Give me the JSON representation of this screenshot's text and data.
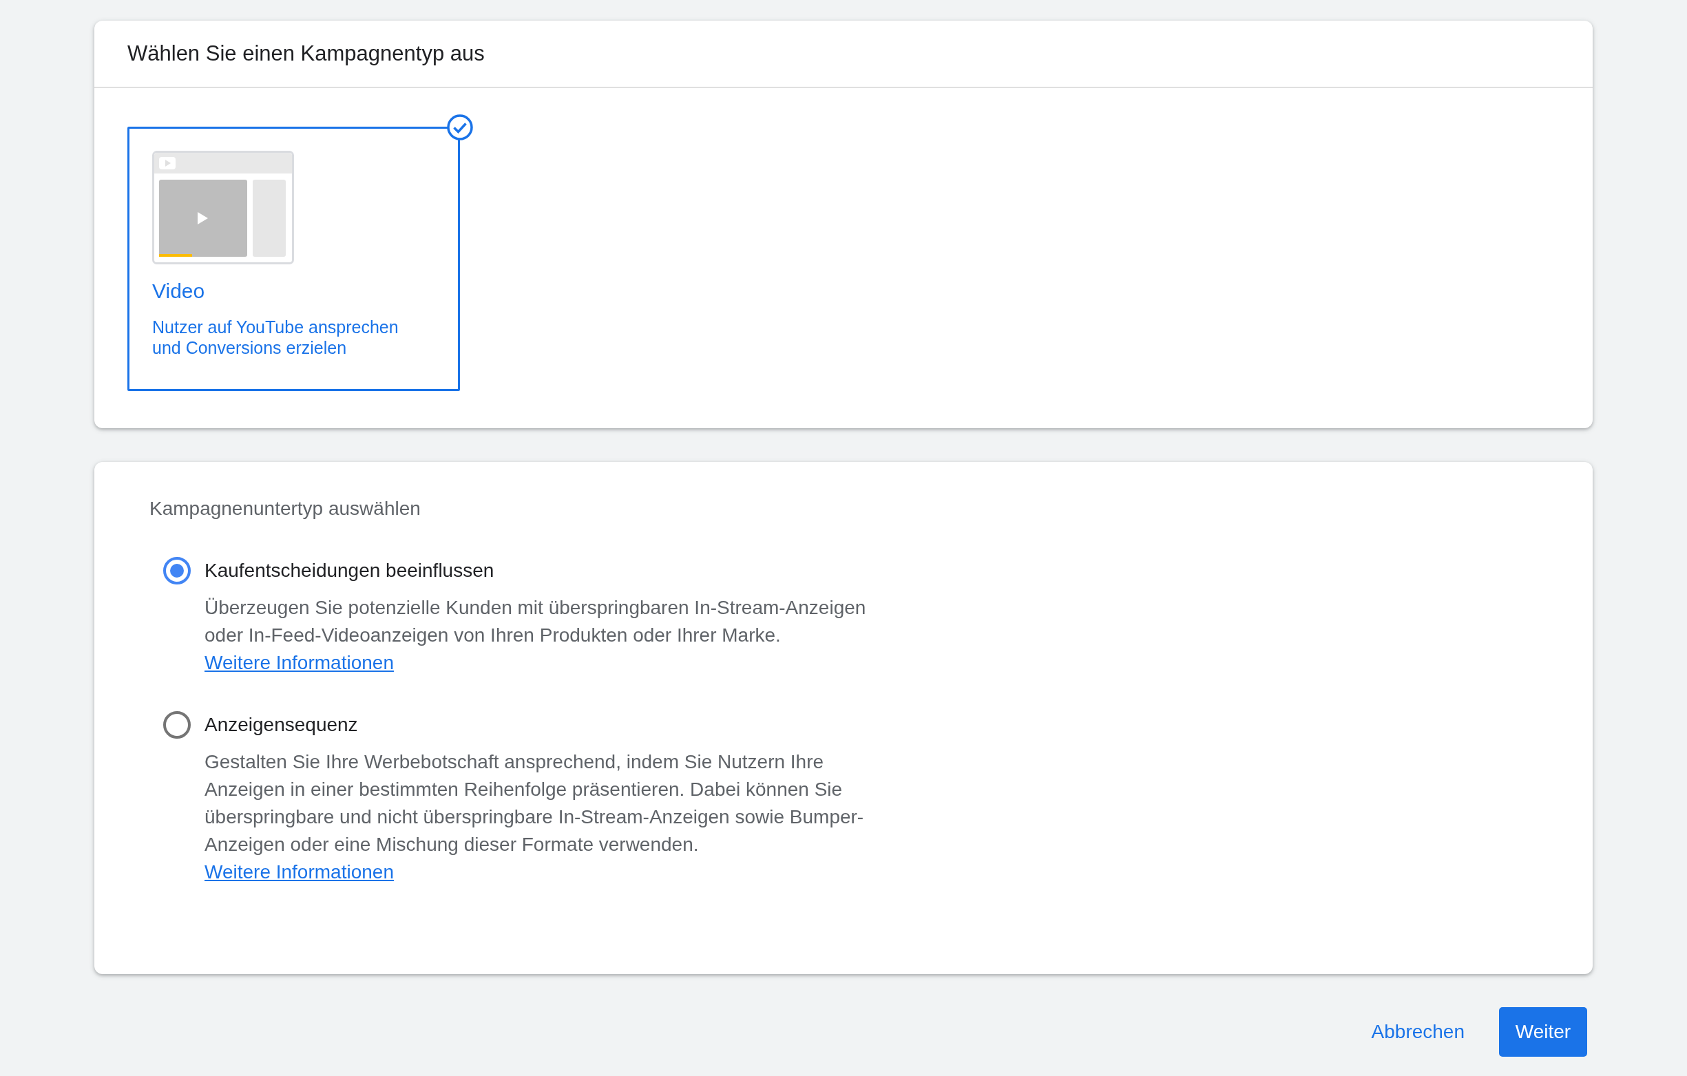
{
  "campaign_type_card": {
    "title": "Wählen Sie einen Kampagnentyp aus",
    "types": [
      {
        "title": "Video",
        "description": "Nutzer auf YouTube ansprechen und Conversions erzielen",
        "selected": true
      }
    ]
  },
  "subtype_card": {
    "heading": "Kampagnenuntertyp auswählen",
    "options": [
      {
        "label": "Kaufentscheidungen beeinflussen",
        "description": "Überzeugen Sie potenzielle Kunden mit überspringbaren In-Stream-Anzeigen oder In-Feed-Videoanzeigen von Ihren Produkten oder Ihrer Marke.",
        "link": "Weitere Informationen",
        "selected": true
      },
      {
        "label": "Anzeigensequenz",
        "description": "Gestalten Sie Ihre Werbebotschaft ansprechend, indem Sie Nutzern Ihre Anzeigen in einer bestimmten Reihenfolge präsentieren. Dabei können Sie überspringbare und nicht überspringbare In-Stream-Anzeigen sowie Bumper-Anzeigen oder eine Mischung dieser Formate verwenden.",
        "link": "Weitere Informationen",
        "selected": false
      }
    ]
  },
  "buttons": [
    {
      "label": "Abbrechen",
      "kind": "text"
    },
    {
      "label": "Weiter",
      "kind": "filled"
    }
  ]
}
